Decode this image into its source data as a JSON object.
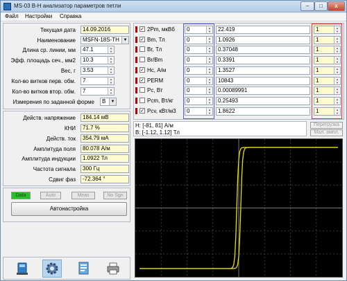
{
  "window": {
    "title": "MS-03 B-H анализатор параметров петли",
    "buttons": {
      "minimize": "–",
      "maximize": "□",
      "close": "x"
    }
  },
  "menu": [
    "Файл",
    "Настройки",
    "Справка"
  ],
  "params": [
    {
      "label": "Текущая дата",
      "value": "14.09.2016"
    },
    {
      "label": "Наименование",
      "value": "MSFN-18S-TH"
    },
    {
      "label": "Длина ср. линии, мм",
      "value": "47.1"
    },
    {
      "label": "Эфф. площадь сеч., мм2",
      "value": "10.3"
    },
    {
      "label": "Вес, г",
      "value": "3.53"
    },
    {
      "label": "Кол-во витков перв. обм.",
      "value": "7"
    },
    {
      "label": "Кол-во витков втор. обм.",
      "value": "7"
    },
    {
      "label": "Измерения по заданной форме",
      "value": "B"
    }
  ],
  "measurements": [
    {
      "label": "Действ. напряжение",
      "value": "184.14 мВ"
    },
    {
      "label": "КНИ",
      "value": "71.7 %"
    },
    {
      "label": "Действ. ток",
      "value": "354.79 мА"
    },
    {
      "label": "Амплитуда поля",
      "value": "80.078 А/м"
    },
    {
      "label": "Амплитуда индукции",
      "value": "1.0922 Тл"
    },
    {
      "label": "Частота сигнала",
      "value": "300 Гц"
    },
    {
      "label": "Сдвиг фаз",
      "value": "-72.364 °"
    }
  ],
  "status": [
    "Data",
    "Auto",
    "Meas",
    "No Sgn"
  ],
  "status_colors": {
    "active": "#22c322",
    "inactive": "#e8e8e8"
  },
  "autoset_button": "Автонастройка",
  "toolbar_icons": [
    "device-icon",
    "gear-icon",
    "document-icon",
    "printer-icon"
  ],
  "results": [
    {
      "label": "2Pm, мкВб",
      "checked": true,
      "spin_left": "0",
      "value": "22.419",
      "spin_right": "1"
    },
    {
      "label": "Bm, Тл",
      "checked": true,
      "spin_left": "0",
      "value": "1.0926",
      "spin_right": "1"
    },
    {
      "label": "Br, Тл",
      "checked": false,
      "spin_left": "0",
      "value": "0.37048",
      "spin_right": "1"
    },
    {
      "label": "Br/Bm",
      "checked": false,
      "spin_left": "0",
      "value": "0.3391",
      "spin_right": "1"
    },
    {
      "label": "Hc, А/м",
      "checked": true,
      "spin_left": "0",
      "value": "1.3527",
      "spin_right": "1"
    },
    {
      "label": "PERM",
      "checked": true,
      "spin_left": "0",
      "value": "10843",
      "spin_right": "1"
    },
    {
      "label": "Pc, Вт",
      "checked": false,
      "spin_left": "0",
      "value": "0.00089991",
      "spin_right": "1"
    },
    {
      "label": "Pcm, Вт/кг",
      "checked": false,
      "spin_left": "0",
      "value": "0.25493",
      "spin_right": "1"
    },
    {
      "label": "Pcv, кВт/м3",
      "checked": true,
      "spin_left": "0",
      "value": "1.8622",
      "spin_right": "1"
    }
  ],
  "scope": {
    "range_h": "H: [-81, 81] А/м",
    "range_b": "B: [-1.12, 1.12] Тл",
    "overload": "Перегрузка",
    "small_ampl": "Мал. ампл.",
    "trace_color": "#e8e000",
    "grid_color": "#3a3a3a"
  }
}
